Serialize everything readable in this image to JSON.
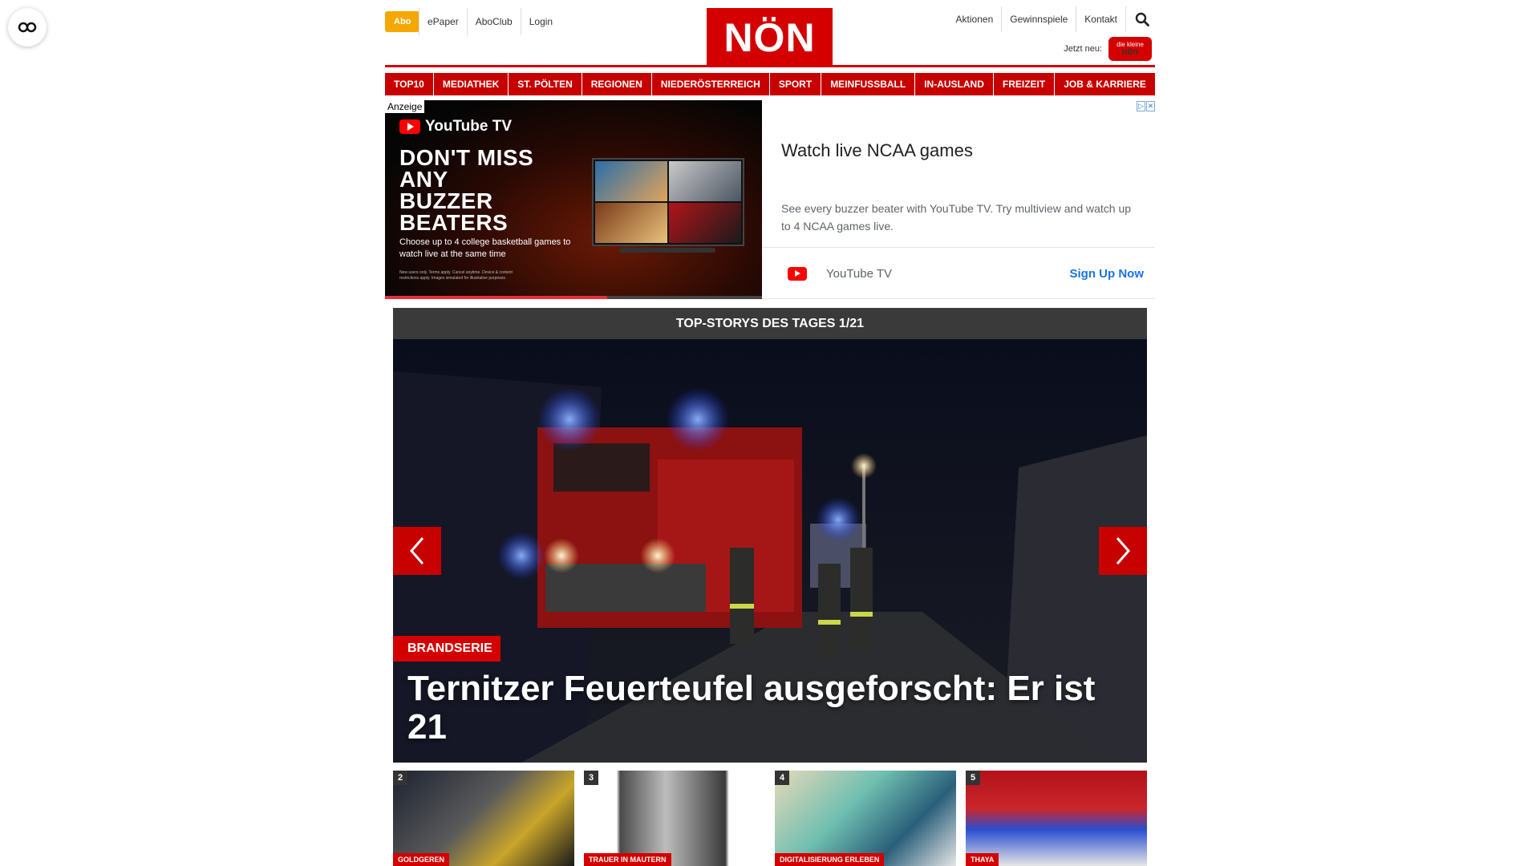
{
  "header": {
    "abo_label": "Abo",
    "links": [
      "ePaper",
      "AboClub",
      "Login"
    ],
    "logo": "NÖN",
    "right_links": [
      "Aktionen",
      "Gewinnspiele",
      "Kontakt"
    ],
    "jetzt_label": "Jetzt neu:",
    "mini_logo_small": "die kleine",
    "mini_logo_main": "nön"
  },
  "nav": [
    "TOP10",
    "MEDIATHEK",
    "ST. PÖLTEN",
    "REGIONEN",
    "NIEDERÖSTERREICH",
    "SPORT",
    "MEINFUSSBALL",
    "IN-AUSLAND",
    "FREIZEIT",
    "JOB & KARRIERE"
  ],
  "ad": {
    "anzeige": "Anzeige",
    "brand": "YouTube TV",
    "headline": "DON'T MISS ANY BUZZER BEATERS",
    "copy": "Choose up to 4 college basketball games to watch live at the same time",
    "fine_print": "New users only. Terms apply. Cancel anytime. Device & content restrictions apply. Images simulated for illustrative purposes.",
    "progress_fraction": 0.59,
    "title": "Watch live NCAA games",
    "description": "See every buzzer beater with YouTube TV. Try multiview and watch up to 4 NCAA games live.",
    "advertiser": "YouTube TV",
    "cta": "Sign Up Now",
    "colors": {
      "cta": "#1a73e8",
      "youtube_red": "#ff0000"
    }
  },
  "top_stories": {
    "header": "TOP-STORYS DES TAGES 1/21",
    "category": "BRANDSERIE",
    "title": "Ternitzer Feuerteufel ausgeforscht: Er ist 21"
  },
  "teasers": [
    {
      "num": "2",
      "tag": "GOLDGEREN"
    },
    {
      "num": "3",
      "tag": "TRAUER IN MAUTERN"
    },
    {
      "num": "4",
      "tag": "DIGITALISIERUNG ERLEBEN"
    },
    {
      "num": "5",
      "tag": "THAYA"
    }
  ],
  "colors": {
    "brand_red": "#d40000",
    "abo_orange": "#f5a800",
    "stories_header": "#3a3a3a"
  }
}
